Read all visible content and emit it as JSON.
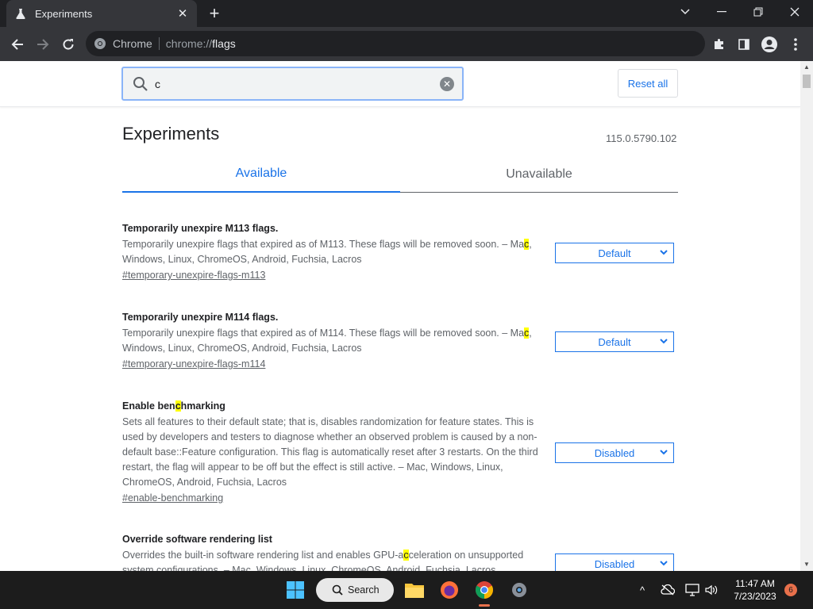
{
  "browser": {
    "tab_title": "Experiments",
    "omnibox_site": "Chrome",
    "url_scheme": "chrome://",
    "url_host": "flags"
  },
  "page": {
    "search_value": "c",
    "reset_label": "Reset all",
    "title": "Experiments",
    "version": "115.0.5790.102",
    "tabs": [
      "Available",
      "Unavailable"
    ],
    "flags": [
      {
        "name": "Temporarily unexpire M113 flags.",
        "desc_before": "Temporarily unexpire flags that expired as of M113. These flags will be removed soon. – Ma",
        "desc_highlight": "c",
        "desc_after": ", Windows, Linux, ChromeOS, Android, Fuchsia, Lacros",
        "link": "#temporary-unexpire-flags-m113",
        "value": "Default"
      },
      {
        "name": "Temporarily unexpire M114 flags.",
        "desc_before": "Temporarily unexpire flags that expired as of M114. These flags will be removed soon. – Ma",
        "desc_highlight": "c",
        "desc_after": ", Windows, Linux, ChromeOS, Android, Fuchsia, Lacros",
        "link": "#temporary-unexpire-flags-m114",
        "value": "Default"
      },
      {
        "name_before": "Enable ben",
        "name_highlight": "c",
        "name_after": "hmarking",
        "desc": "Sets all features to their default state; that is, disables randomization for feature states. This is used by developers and testers to diagnose whether an observed problem is caused by a non-default base::Feature configuration. This flag is automatically reset after 3 restarts. On the third restart, the flag will appear to be off but the effect is still active. – Mac, Windows, Linux, ChromeOS, Android, Fuchsia, Lacros",
        "link": "#enable-benchmarking",
        "value": "Disabled"
      },
      {
        "name": "Override software rendering list",
        "desc_before": "Overrides the built-in software rendering list and enables GPU-a",
        "desc_highlight": "c",
        "desc_after": "celeration on unsupported system configurations. – Mac, Windows, Linux, ChromeOS, Android, Fuchsia, Lacros",
        "value": "Disabled"
      }
    ]
  },
  "taskbar": {
    "search_label": "Search",
    "time": "11:47 AM",
    "date": "7/23/2023",
    "notification_count": "6"
  },
  "colors": {
    "accent": "#1a73e8",
    "highlight": "#ffff00",
    "titlebar": "#202124",
    "toolbar": "#35363a"
  }
}
